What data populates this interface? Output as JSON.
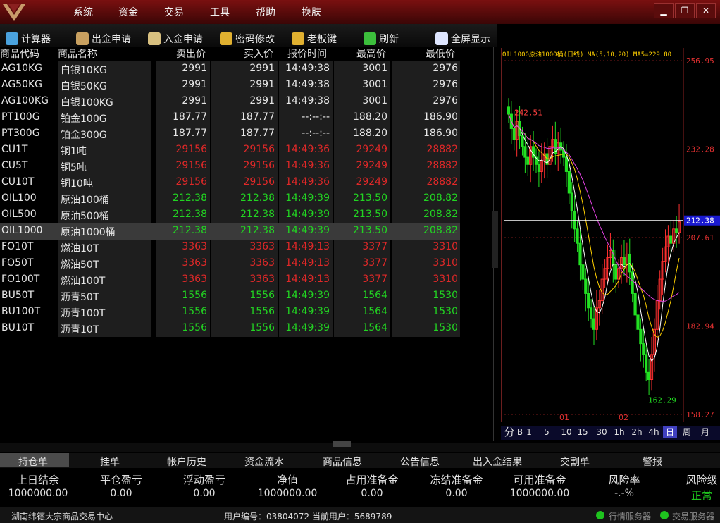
{
  "menu": [
    "系统",
    "资金",
    "交易",
    "工具",
    "帮助",
    "换肤"
  ],
  "window_controls": {
    "minimize": "▁",
    "restore": "❐",
    "close": "✕"
  },
  "toolbar": [
    {
      "label": "计算器",
      "icon": "calculator-icon"
    },
    {
      "label": "出金申请",
      "icon": "money-bag-icon"
    },
    {
      "label": "入金申请",
      "icon": "deposit-icon"
    },
    {
      "label": "密码修改",
      "icon": "key-icon"
    },
    {
      "label": "老板键",
      "icon": "hand-icon"
    },
    {
      "label": "刷新",
      "icon": "refresh-icon"
    },
    {
      "label": "全屏显示",
      "icon": "fullscreen-icon"
    }
  ],
  "table": {
    "headers": [
      "商品代码",
      "商品名称",
      "卖出价",
      "买入价",
      "报价时间",
      "最高价",
      "最低价"
    ],
    "rows": [
      {
        "code": "AG10KG",
        "name": "白银10KG",
        "sell": "2991",
        "buy": "2991",
        "time": "14:49:38",
        "high": "3001",
        "low": "2976",
        "color": "#e6e6e6"
      },
      {
        "code": "AG50KG",
        "name": "白银50KG",
        "sell": "2991",
        "buy": "2991",
        "time": "14:49:38",
        "high": "3001",
        "low": "2976",
        "color": "#e6e6e6"
      },
      {
        "code": "AG100KG",
        "name": "白银100KG",
        "sell": "2991",
        "buy": "2991",
        "time": "14:49:38",
        "high": "3001",
        "low": "2976",
        "color": "#e6e6e6"
      },
      {
        "code": "PT100G",
        "name": "铂金100G",
        "sell": "187.77",
        "buy": "187.77",
        "time": "--:--:--",
        "high": "188.20",
        "low": "186.90",
        "color": "#e6e6e6"
      },
      {
        "code": "PT300G",
        "name": "铂金300G",
        "sell": "187.77",
        "buy": "187.77",
        "time": "--:--:--",
        "high": "188.20",
        "low": "186.90",
        "color": "#e6e6e6"
      },
      {
        "code": "CU1T",
        "name": "铜1吨",
        "sell": "29156",
        "buy": "29156",
        "time": "14:49:36",
        "high": "29249",
        "low": "28882",
        "color": "#e02828"
      },
      {
        "code": "CU5T",
        "name": "铜5吨",
        "sell": "29156",
        "buy": "29156",
        "time": "14:49:36",
        "high": "29249",
        "low": "28882",
        "color": "#e02828"
      },
      {
        "code": "CU10T",
        "name": "铜10吨",
        "sell": "29156",
        "buy": "29156",
        "time": "14:49:36",
        "high": "29249",
        "low": "28882",
        "color": "#e02828"
      },
      {
        "code": "OIL100",
        "name": "原油100桶",
        "sell": "212.38",
        "buy": "212.38",
        "time": "14:49:39",
        "high": "213.50",
        "low": "208.82",
        "color": "#22d422"
      },
      {
        "code": "OIL500",
        "name": "原油500桶",
        "sell": "212.38",
        "buy": "212.38",
        "time": "14:49:39",
        "high": "213.50",
        "low": "208.82",
        "color": "#22d422"
      },
      {
        "code": "OIL1000",
        "name": "原油1000桶",
        "sell": "212.38",
        "buy": "212.38",
        "time": "14:49:39",
        "high": "213.50",
        "low": "208.82",
        "color": "#22d422",
        "selected": true
      },
      {
        "code": "FO10T",
        "name": "燃油10T",
        "sell": "3363",
        "buy": "3363",
        "time": "14:49:13",
        "high": "3377",
        "low": "3310",
        "color": "#e02828"
      },
      {
        "code": "FO50T",
        "name": "燃油50T",
        "sell": "3363",
        "buy": "3363",
        "time": "14:49:13",
        "high": "3377",
        "low": "3310",
        "color": "#e02828"
      },
      {
        "code": "FO100T",
        "name": "燃油100T",
        "sell": "3363",
        "buy": "3363",
        "time": "14:49:13",
        "high": "3377",
        "low": "3310",
        "color": "#e02828"
      },
      {
        "code": "BU50T",
        "name": "沥青50T",
        "sell": "1556",
        "buy": "1556",
        "time": "14:49:39",
        "high": "1564",
        "low": "1530",
        "color": "#22d422"
      },
      {
        "code": "BU100T",
        "name": "沥青100T",
        "sell": "1556",
        "buy": "1556",
        "time": "14:49:39",
        "high": "1564",
        "low": "1530",
        "color": "#22d422"
      },
      {
        "code": "BU10T",
        "name": "沥青10T",
        "sell": "1556",
        "buy": "1556",
        "time": "14:49:39",
        "high": "1564",
        "low": "1530",
        "color": "#22d422"
      }
    ]
  },
  "chart": {
    "header": "OIL1000原油1000桶(日线) MA(5,10,20) MA5=229.80",
    "price_labels": [
      "256.95",
      "232.28",
      "207.61",
      "182.94",
      "158.27"
    ],
    "current_price": "212.38",
    "marker_high": "242.51",
    "marker_low": "162.29",
    "x_labels": [
      "01",
      "02"
    ],
    "periods": [
      "分",
      "B",
      "1",
      "5",
      "10",
      "15",
      "30",
      "1h",
      "2h",
      "4h",
      "日",
      "周",
      "月"
    ],
    "active_period": "日"
  },
  "chart_data": {
    "type": "candlestick",
    "title": "OIL1000原油1000桶(日线)",
    "indicator": "MA(5,10,20) MA5=229.80",
    "ylim": [
      158.27,
      256.95
    ],
    "y_ticks": [
      256.95,
      232.28,
      207.61,
      182.94,
      158.27
    ],
    "x_tick_labels": [
      "01",
      "02"
    ],
    "current_price": 212.38,
    "annotated_high": 242.51,
    "annotated_low": 162.29,
    "close": [
      242,
      238,
      235,
      240,
      236,
      233,
      230,
      228,
      233,
      230,
      228,
      226,
      229,
      231,
      228,
      233,
      235,
      231,
      234,
      232,
      230,
      226,
      220,
      215,
      210,
      206,
      200,
      196,
      192,
      188,
      185,
      182,
      188,
      190,
      196,
      199,
      202,
      204,
      200,
      196,
      199,
      202,
      200,
      203,
      198,
      192,
      186,
      182,
      178,
      175,
      170,
      168,
      175,
      182,
      190,
      196,
      201,
      205,
      208,
      206,
      210,
      209,
      212
    ]
  },
  "tabs": [
    "持仓单",
    "挂单",
    "帐户历史",
    "资金流水",
    "商品信息",
    "公告信息",
    "出入金结果",
    "交割单",
    "警报"
  ],
  "active_tab": "持仓单",
  "account": {
    "labels": [
      "上日结余",
      "平仓盈亏",
      "浮动盈亏",
      "净值",
      "占用准备金",
      "冻结准备金",
      "可用准备金",
      "风险率",
      "风险级"
    ],
    "values": [
      "1000000.00",
      "0.00",
      "0.00",
      "1000000.00",
      "0.00",
      "0.00",
      "1000000.00",
      "-.-%",
      "正常"
    ]
  },
  "status": {
    "center": "湖南纬德大宗商品交易中心",
    "user_info": "用户编号：03804072  当前用户：5689789",
    "quote_server": "行情服务器",
    "trade_server": "交易服务器"
  }
}
